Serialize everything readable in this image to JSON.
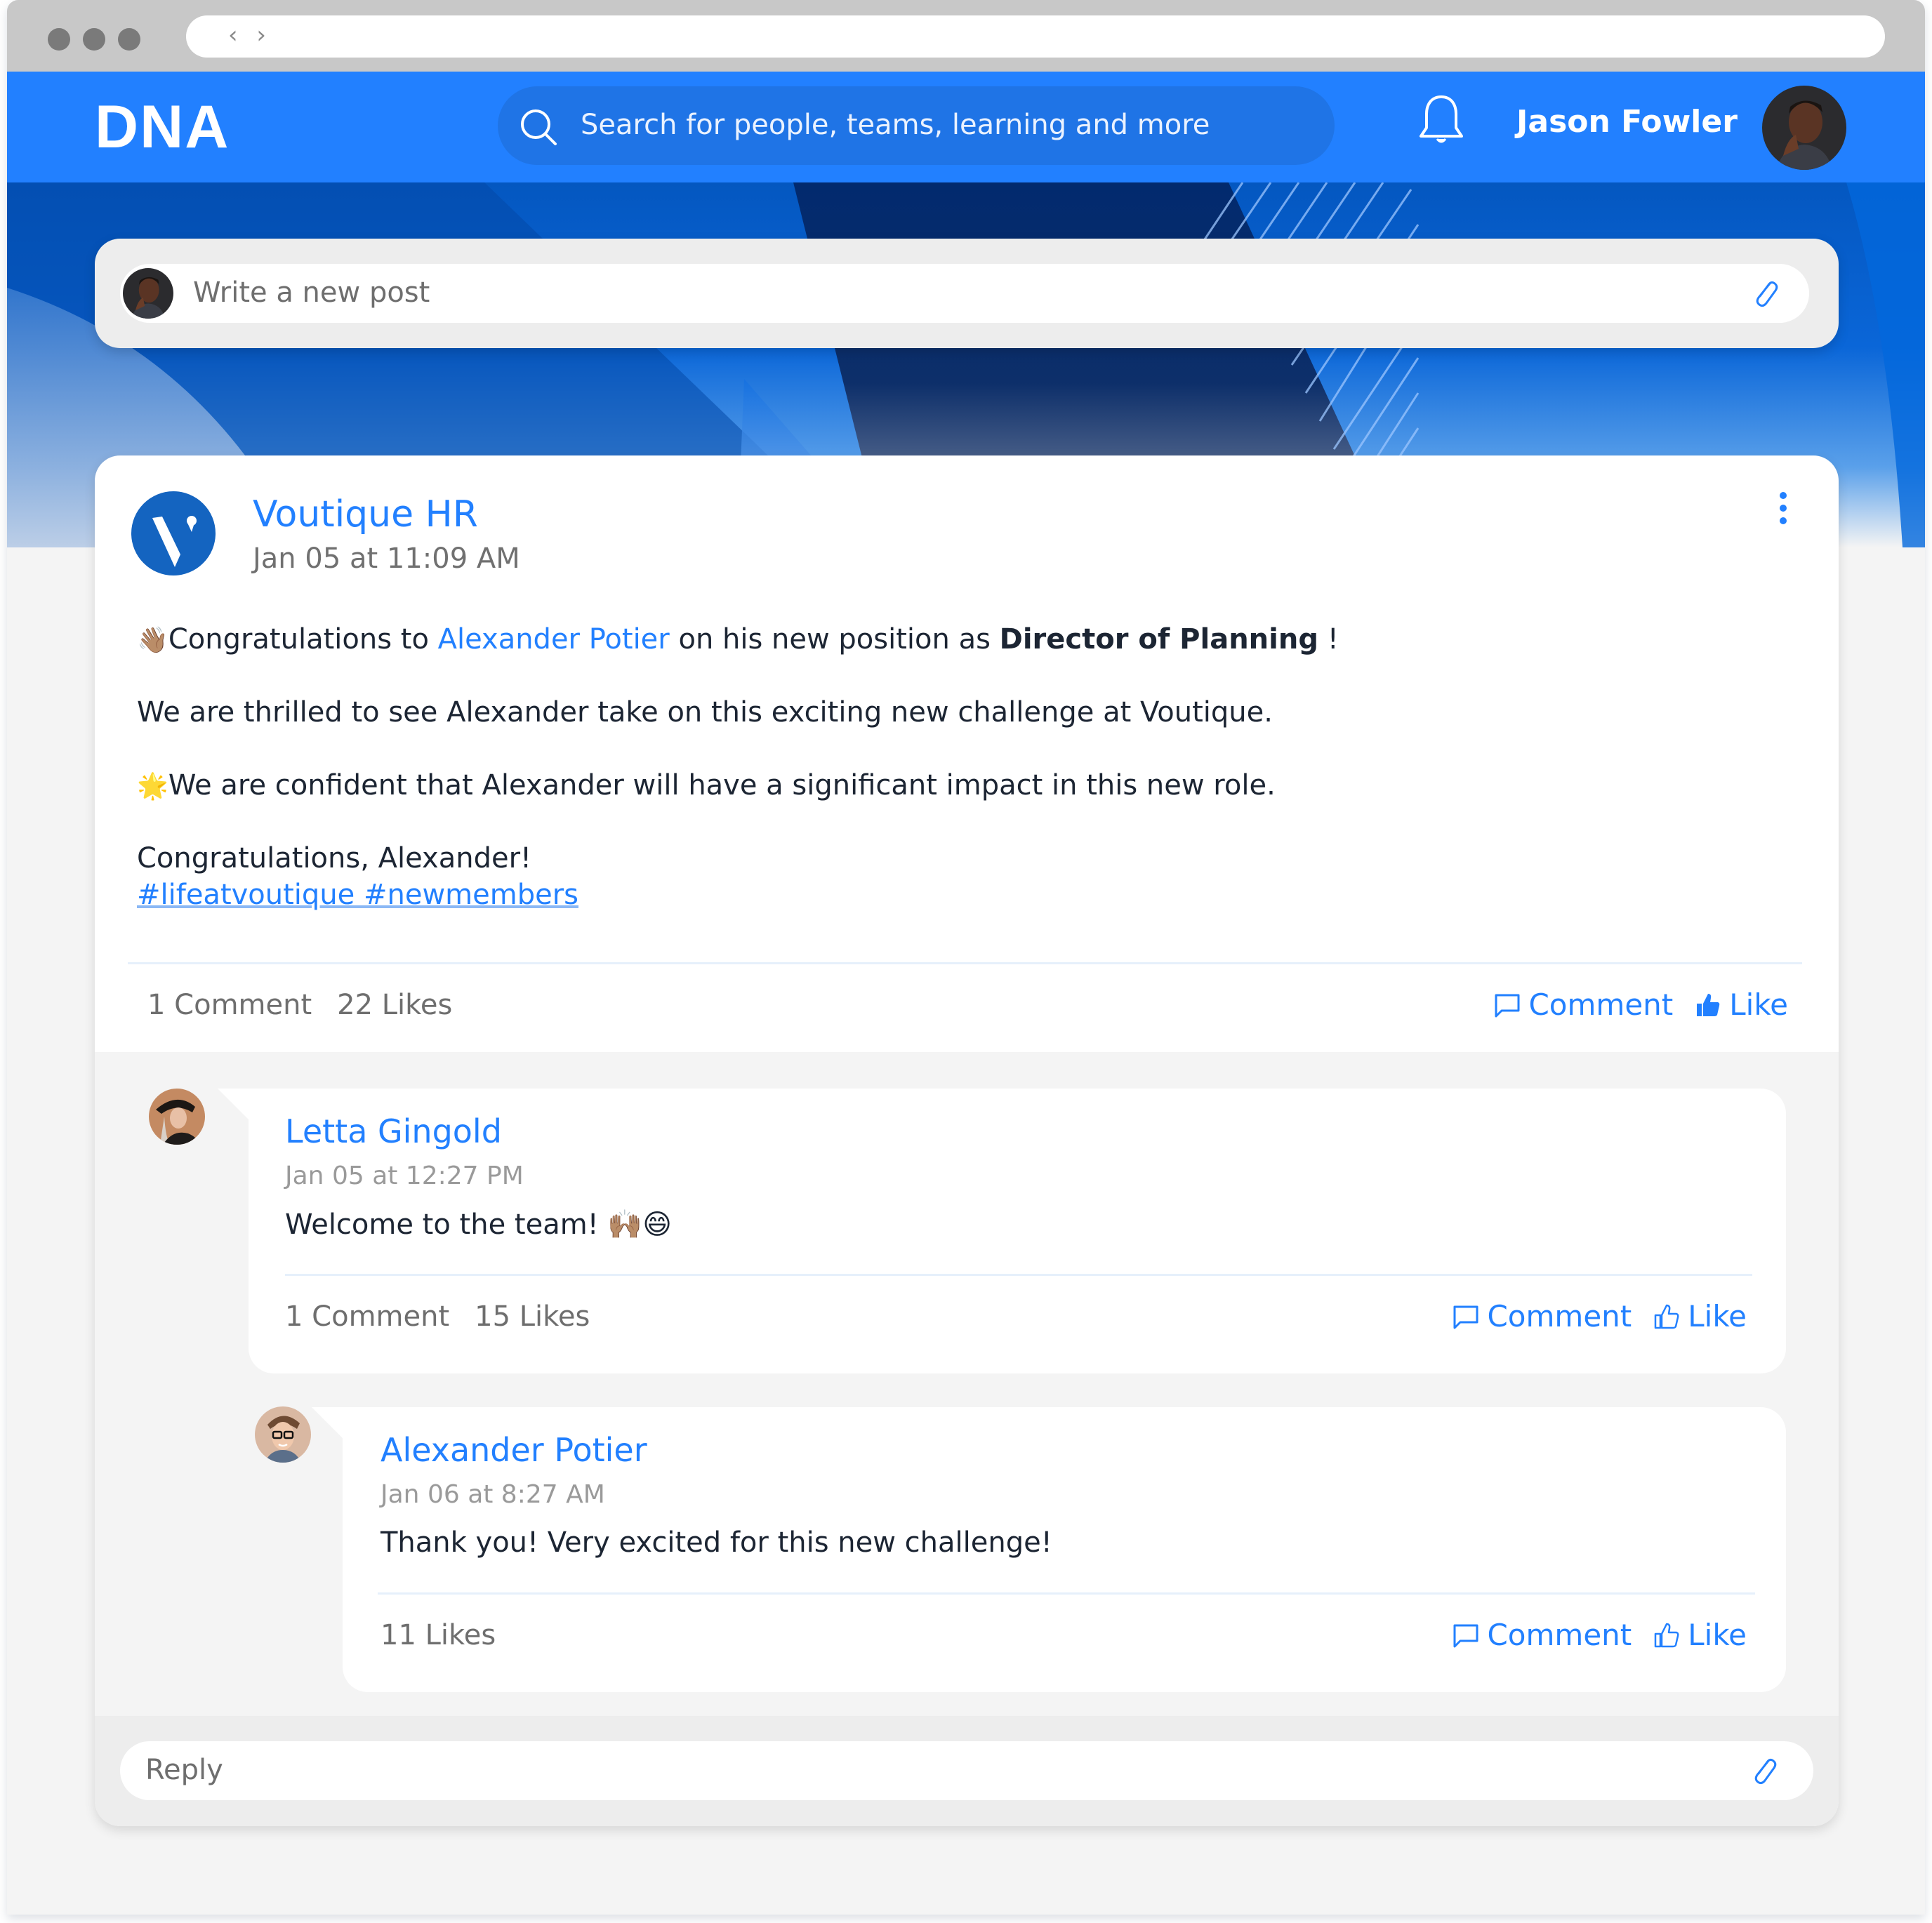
{
  "browser": {
    "nav_arrows": "‹ ›"
  },
  "header": {
    "logo": "DNA",
    "search_placeholder": "Search for people, teams, learning and more",
    "user_name": "Jason Fowler",
    "brand_color": "#2280ff"
  },
  "new_post": {
    "placeholder": "Write a new post"
  },
  "post": {
    "author": "Voutique HR",
    "timestamp": "Jan 05 at 11:09 AM",
    "body": {
      "line1_emoji": "👋🏽",
      "line1_pre": "Congratulations to ",
      "line1_mention": "Alexander Potier",
      "line1_mid": " on his new position as ",
      "line1_bold": "Director of Planning",
      "line1_post": " !",
      "line2": "We are thrilled to see Alexander take on this exciting new challenge at Voutique.",
      "line3_emoji": "🌟",
      "line3": "We are confident that Alexander will have a significant impact in this new role.",
      "line4": "Congratulations, Alexander!",
      "hashtags": "#lifeatvoutique #newmembers"
    },
    "comment_count": "1 Comment",
    "like_count": "22 Likes",
    "comment_action": "Comment",
    "like_action": "Like",
    "liked": true
  },
  "comments": [
    {
      "author": "Letta Gingold",
      "timestamp": "Jan 05 at 12:27 PM",
      "text": "Welcome to the team! 🙌🏽😄",
      "comment_count": "1 Comment",
      "like_count": "15 Likes",
      "comment_action": "Comment",
      "like_action": "Like"
    },
    {
      "author": "Alexander Potier",
      "timestamp": "Jan 06 at 8:27 AM",
      "text": "Thank you! Very excited for this new challenge!",
      "like_count": "11 Likes",
      "comment_action": "Comment",
      "like_action": "Like"
    }
  ],
  "reply": {
    "placeholder": "Reply"
  }
}
